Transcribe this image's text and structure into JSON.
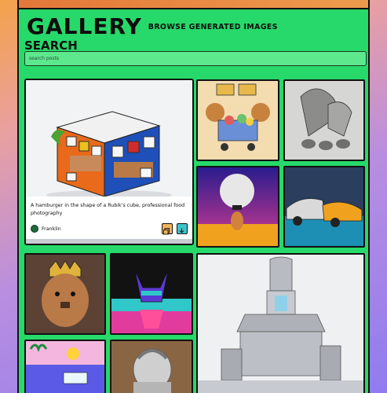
{
  "header": {
    "title": "GALLERY",
    "subtitle": "BROWSE GENERATED IMAGES"
  },
  "search": {
    "label": "SEARCH",
    "placeholder": "search posts"
  },
  "featured": {
    "prompt": "A hamburger in the shape of a Rubik's cube, professional food photography",
    "author": "Franklin",
    "copy_icon": "copy-icon",
    "download_icon": "download-icon"
  },
  "colors": {
    "page_green": "#27d96a",
    "search_green": "#5ee88e",
    "copy_button": "#f2b35c",
    "download_button": "#3dc3c7",
    "top_bar": "#e2773a"
  }
}
